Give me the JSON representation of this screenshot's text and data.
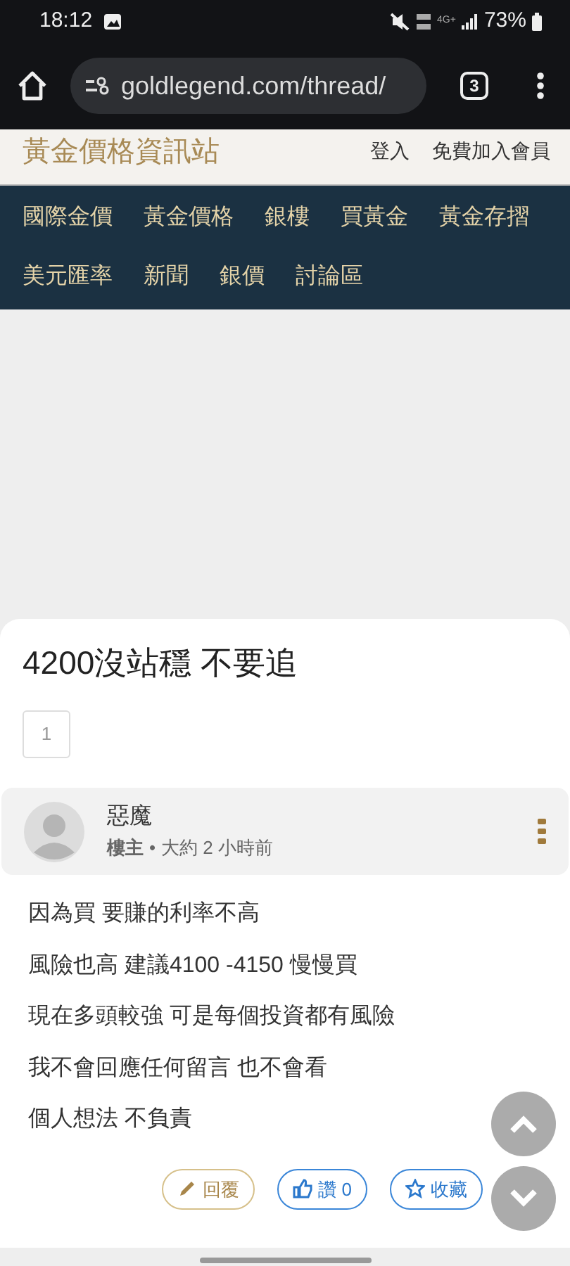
{
  "status_bar": {
    "time": "18:12",
    "network": "4G+",
    "battery": "73%"
  },
  "browser": {
    "url": "goldlegend.com/thread/",
    "tab_count": "3"
  },
  "site": {
    "title": "黃金價格資訊站",
    "links": [
      "登入",
      "免費加入會員"
    ]
  },
  "nav": [
    "國際金價",
    "黃金價格",
    "銀樓",
    "買黃金",
    "黃金存摺",
    "美元匯率",
    "新聞",
    "銀價",
    "討論區"
  ],
  "thread": {
    "title": "4200沒站穩 不要追",
    "pages": [
      "1"
    ]
  },
  "post": {
    "author": "惡魔",
    "role": "樓主",
    "separator": "•",
    "time": "大約 2 小時前",
    "lines": [
      "因為買 要賺的利率不高",
      "風險也高 建議4100 -4150 慢慢買",
      "現在多頭較強 可是每個投資都有風險",
      "我不會回應任何留言 也不會看",
      "個人想法 不負責"
    ],
    "actions": [
      {
        "kind": "reply",
        "label": "回覆"
      },
      {
        "kind": "like",
        "label": "讚 0"
      },
      {
        "kind": "favorite",
        "label": "收藏"
      }
    ]
  }
}
